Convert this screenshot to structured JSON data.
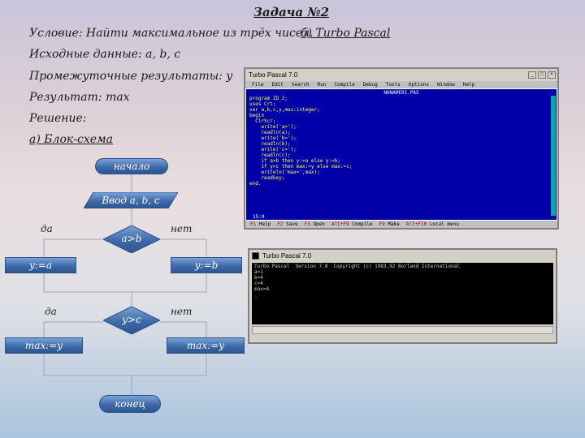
{
  "task": {
    "title": "Задача №2",
    "condition": "Условие: Найти максимальное из трёх чисел.",
    "input": "Исходные данные: a, b, c",
    "intermediate": "Промежуточные результаты: y",
    "result": "Результат: max",
    "solution": "Решение:",
    "flowchart_heading": "а) Блок-схема",
    "pascal_heading": "б) Turbo Pascal"
  },
  "flowchart": {
    "start": "начало",
    "input": "Ввод a, b, c",
    "cond1": "a>b",
    "yes1": "да",
    "no1": "нет",
    "assign_a": "y:=a",
    "assign_b": "y:=b",
    "cond2": "y>c",
    "yes2": "да",
    "no2": "нет",
    "max_y_left": "max:=y",
    "max_y_right": "max:=y",
    "end": "конец"
  },
  "editor": {
    "window_title": "Turbo Pascal 7.0",
    "menu": [
      "File",
      "Edit",
      "Search",
      "Run",
      "Compile",
      "Debug",
      "Tools",
      "Options",
      "Window",
      "Help"
    ],
    "file_name": "NONAME01.PAS",
    "code": "program ZD_2;\nuses Crt;\nvar a,b,c,y,max:integer;\nbegin\n  ClrScr;\n    write('a=');\n    readln(a);\n    write('b=');\n    readln(b);\n    write('c=');\n    readln(c);\n    if a>b then y:=a else y:=b;\n    if y>c then max:=y else max:=c;\n    writeln('max=',max);\n    readkey;\nend.",
    "status": "15:9",
    "function_keys": [
      {
        "key": "F1",
        "label": "Help"
      },
      {
        "key": "F2",
        "label": "Save"
      },
      {
        "key": "F3",
        "label": "Open"
      },
      {
        "key": "Alt+F9",
        "label": "Compile"
      },
      {
        "key": "F9",
        "label": "Make"
      },
      {
        "key": "Alt+F10",
        "label": "Local menu"
      }
    ]
  },
  "output": {
    "window_title": "Turbo Pascal 7.0",
    "text": "Turbo Pascal  Version 7.0  Copyright (c) 1983,92 Borland International\na=1\nb=4\nc=4\nmax=4\n_"
  },
  "colors": {
    "shape_fill": "#3e6aa8",
    "editor_bg": "#0000a8",
    "editor_text": "#ffff55"
  }
}
